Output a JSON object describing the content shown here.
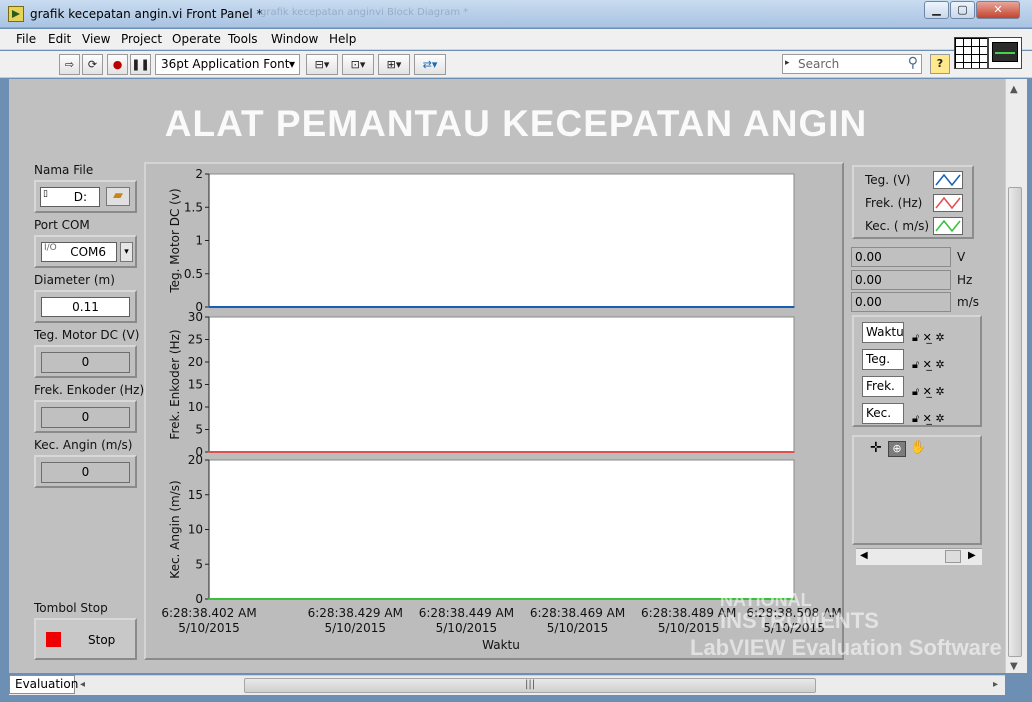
{
  "window": {
    "title": "grafik kecepatan angin.vi Front Panel *",
    "ghost_title": "grafik kecepatan anginvi Block Diagram *"
  },
  "menu": [
    "File",
    "Edit",
    "View",
    "Project",
    "Operate",
    "Tools",
    "Window",
    "Help"
  ],
  "toolbar": {
    "font": "36pt Application Font",
    "search_placeholder": "Search",
    "help": "?"
  },
  "panel": {
    "title": "ALAT PEMANTAU  KECEPATAN ANGIN"
  },
  "controls": {
    "nama_file": {
      "label": "Nama File",
      "value": "D:"
    },
    "port_com": {
      "label": "Port COM",
      "value": "COM6"
    },
    "diameter": {
      "label": "Diameter (m)",
      "value": "0.11"
    },
    "teg_motor": {
      "label": "Teg. Motor DC (V)",
      "value": "0"
    },
    "frek_enkoder": {
      "label": "Frek. Enkoder (Hz)",
      "value": "0"
    },
    "kec_angin": {
      "label": "Kec. Angin (m/s)",
      "value": "0"
    },
    "stop": {
      "label": "Tombol Stop",
      "button": "Stop"
    }
  },
  "legend": [
    {
      "name": "Teg. (V)",
      "color": "#1a5fb4"
    },
    {
      "name": "Frek. (Hz)",
      "color": "#e05050"
    },
    {
      "name": "Kec. ( m/s)",
      "color": "#38c038"
    }
  ],
  "indicators": [
    {
      "value": "0.00",
      "unit": "V"
    },
    {
      "value": "0.00",
      "unit": "Hz"
    },
    {
      "value": "0.00",
      "unit": "m/s"
    }
  ],
  "scale_legend": [
    "Waktu",
    "Teg.",
    "Frek.",
    "Kec."
  ],
  "status": {
    "tab": "Evaluation"
  },
  "watermark": {
    "line1": "NATIONAL",
    "line2": "INSTRUMENTS",
    "line3": "LabVIEW Evaluation Software"
  },
  "chart_data": {
    "type": "line",
    "xlabel": "Waktu",
    "x_ticks": [
      {
        "time": "6:28:38.402 AM",
        "date": "5/10/2015"
      },
      {
        "time": "6:28:38.429 AM",
        "date": "5/10/2015"
      },
      {
        "time": "6:28:38.449 AM",
        "date": "5/10/2015"
      },
      {
        "time": "6:28:38.469 AM",
        "date": "5/10/2015"
      },
      {
        "time": "6:28:38.489 AM",
        "date": "5/10/2015"
      },
      {
        "time": "6:28:38.508 AM",
        "date": "5/10/2015"
      }
    ],
    "plots": [
      {
        "ylabel": "Teg. Motor DC (v)",
        "ylim": [
          0,
          2
        ],
        "yticks": [
          "2",
          "1.5",
          "1",
          "0.5",
          "0"
        ],
        "series": {
          "name": "Teg. (V)",
          "color": "#1a5fb4",
          "values": [
            0,
            0,
            0,
            0,
            0,
            0
          ]
        }
      },
      {
        "ylabel": "Frek. Enkoder (Hz)",
        "ylim": [
          0,
          30
        ],
        "yticks": [
          "30",
          "25",
          "20",
          "15",
          "10",
          "5",
          "0"
        ],
        "series": {
          "name": "Frek. (Hz)",
          "color": "#e05050",
          "values": [
            0,
            0,
            0,
            0,
            0,
            0
          ]
        }
      },
      {
        "ylabel": "Kec. Angin (m/s)",
        "ylim": [
          0,
          20
        ],
        "yticks": [
          "20",
          "15",
          "10",
          "5",
          "0"
        ],
        "series": {
          "name": "Kec. ( m/s)",
          "color": "#38c038",
          "values": [
            0,
            0,
            0,
            0,
            0,
            0
          ]
        }
      }
    ],
    "grid": false
  }
}
